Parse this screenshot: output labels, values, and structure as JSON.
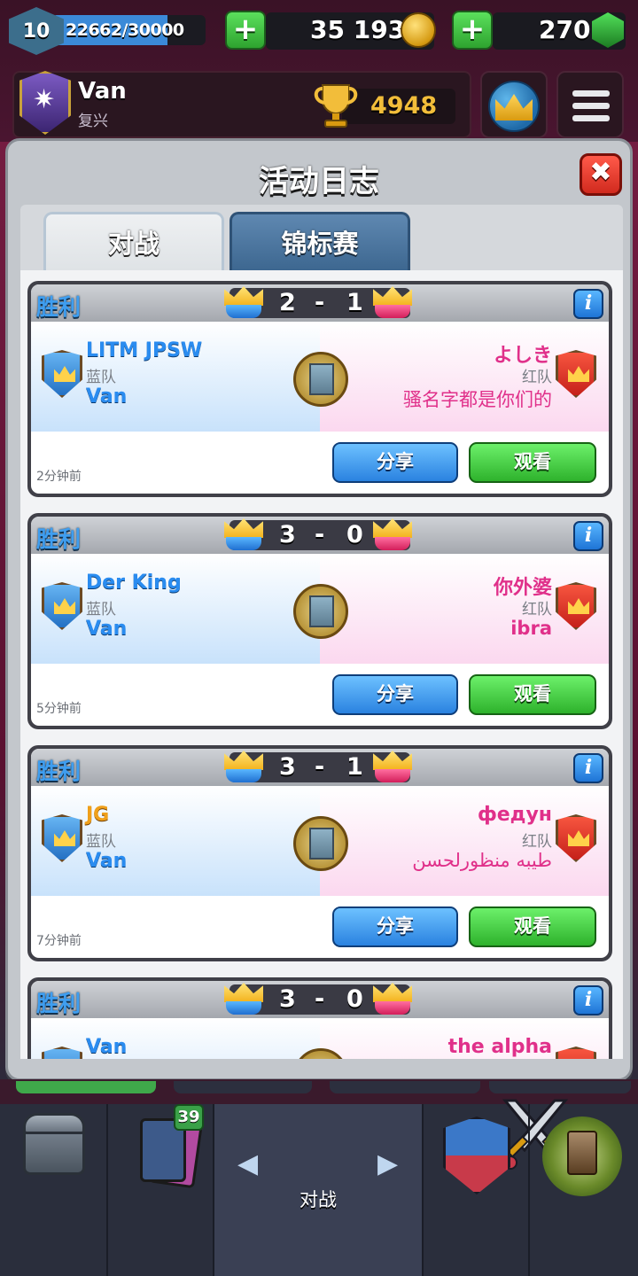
{
  "hud": {
    "level": "10",
    "xp": "22662/30000",
    "xp_fraction": 0.755,
    "gold": "35 193",
    "gems": "270",
    "player_name": "Van",
    "clan_name": "复兴",
    "trophies": "4948"
  },
  "modal": {
    "title": "活动日志",
    "close_label": "✖",
    "tabs": [
      {
        "label": "对战",
        "active": true
      },
      {
        "label": "锦标赛",
        "active": false
      }
    ]
  },
  "battles": [
    {
      "result": "胜利",
      "blue_score": "2",
      "dash": "-",
      "red_score": "1",
      "info_label": "i",
      "blue_player": "LITM JPSW",
      "blue_team": "蓝队",
      "blue_clan": "Van",
      "red_player": "よしき",
      "red_team": "红队",
      "red_clan": "骚名字都是你们的",
      "time": "2分钟前",
      "share_label": "分享",
      "watch_label": "观看"
    },
    {
      "result": "胜利",
      "blue_score": "3",
      "dash": "-",
      "red_score": "0",
      "info_label": "i",
      "blue_player": "Der King",
      "blue_team": "蓝队",
      "blue_clan": "Van",
      "red_player": "你外婆",
      "red_team": "红队",
      "red_clan": "ibra",
      "time": "5分钟前",
      "share_label": "分享",
      "watch_label": "观看"
    },
    {
      "result": "胜利",
      "blue_score": "3",
      "dash": "-",
      "red_score": "1",
      "info_label": "i",
      "blue_player": "JG",
      "blue_team": "蓝队",
      "blue_clan": "Van",
      "red_player": "федун",
      "red_team": "红队",
      "red_clan": "طيبه منظورلحسن",
      "time": "7分钟前",
      "share_label": "分享",
      "watch_label": "观看"
    },
    {
      "result": "胜利",
      "blue_score": "3",
      "dash": "-",
      "red_score": "0",
      "info_label": "i",
      "blue_player": "Van",
      "red_player": "the alpha"
    }
  ],
  "bottom_nav": {
    "cards_badge": "39",
    "battle_label": "对战",
    "left_arrow": "◀",
    "right_arrow": "▶"
  },
  "colors": {
    "blue_accent": "#2a8cf0",
    "red_accent": "#e0308a",
    "win_label": "#3f9ef0",
    "share_button": "#2a82e0",
    "watch_button": "#2eb22c",
    "close_button": "#d12a1e"
  }
}
